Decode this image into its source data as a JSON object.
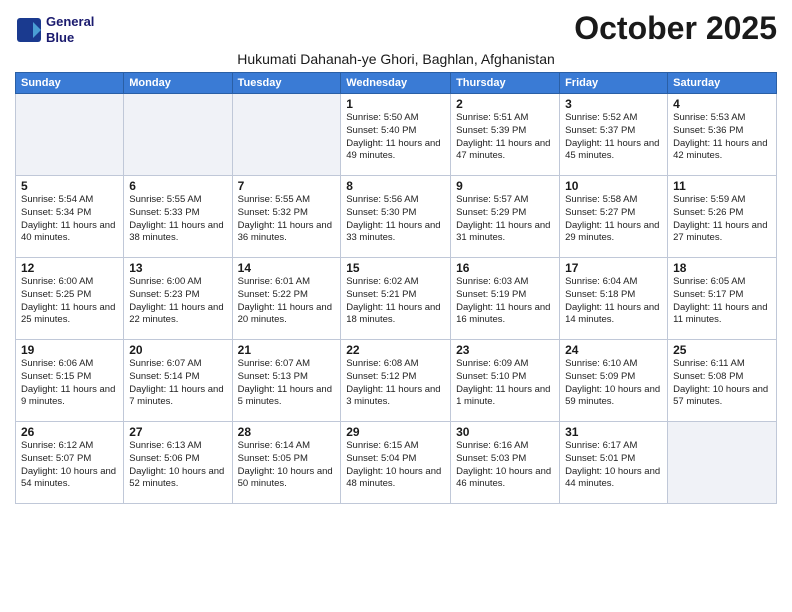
{
  "logo": {
    "line1": "General",
    "line2": "Blue"
  },
  "title": "October 2025",
  "subtitle": "Hukumati Dahanah-ye Ghori, Baghlan, Afghanistan",
  "headers": [
    "Sunday",
    "Monday",
    "Tuesday",
    "Wednesday",
    "Thursday",
    "Friday",
    "Saturday"
  ],
  "weeks": [
    [
      {
        "day": "",
        "info": ""
      },
      {
        "day": "",
        "info": ""
      },
      {
        "day": "",
        "info": ""
      },
      {
        "day": "1",
        "info": "Sunrise: 5:50 AM\nSunset: 5:40 PM\nDaylight: 11 hours\nand 49 minutes."
      },
      {
        "day": "2",
        "info": "Sunrise: 5:51 AM\nSunset: 5:39 PM\nDaylight: 11 hours\nand 47 minutes."
      },
      {
        "day": "3",
        "info": "Sunrise: 5:52 AM\nSunset: 5:37 PM\nDaylight: 11 hours\nand 45 minutes."
      },
      {
        "day": "4",
        "info": "Sunrise: 5:53 AM\nSunset: 5:36 PM\nDaylight: 11 hours\nand 42 minutes."
      }
    ],
    [
      {
        "day": "5",
        "info": "Sunrise: 5:54 AM\nSunset: 5:34 PM\nDaylight: 11 hours\nand 40 minutes."
      },
      {
        "day": "6",
        "info": "Sunrise: 5:55 AM\nSunset: 5:33 PM\nDaylight: 11 hours\nand 38 minutes."
      },
      {
        "day": "7",
        "info": "Sunrise: 5:55 AM\nSunset: 5:32 PM\nDaylight: 11 hours\nand 36 minutes."
      },
      {
        "day": "8",
        "info": "Sunrise: 5:56 AM\nSunset: 5:30 PM\nDaylight: 11 hours\nand 33 minutes."
      },
      {
        "day": "9",
        "info": "Sunrise: 5:57 AM\nSunset: 5:29 PM\nDaylight: 11 hours\nand 31 minutes."
      },
      {
        "day": "10",
        "info": "Sunrise: 5:58 AM\nSunset: 5:27 PM\nDaylight: 11 hours\nand 29 minutes."
      },
      {
        "day": "11",
        "info": "Sunrise: 5:59 AM\nSunset: 5:26 PM\nDaylight: 11 hours\nand 27 minutes."
      }
    ],
    [
      {
        "day": "12",
        "info": "Sunrise: 6:00 AM\nSunset: 5:25 PM\nDaylight: 11 hours\nand 25 minutes."
      },
      {
        "day": "13",
        "info": "Sunrise: 6:00 AM\nSunset: 5:23 PM\nDaylight: 11 hours\nand 22 minutes."
      },
      {
        "day": "14",
        "info": "Sunrise: 6:01 AM\nSunset: 5:22 PM\nDaylight: 11 hours\nand 20 minutes."
      },
      {
        "day": "15",
        "info": "Sunrise: 6:02 AM\nSunset: 5:21 PM\nDaylight: 11 hours\nand 18 minutes."
      },
      {
        "day": "16",
        "info": "Sunrise: 6:03 AM\nSunset: 5:19 PM\nDaylight: 11 hours\nand 16 minutes."
      },
      {
        "day": "17",
        "info": "Sunrise: 6:04 AM\nSunset: 5:18 PM\nDaylight: 11 hours\nand 14 minutes."
      },
      {
        "day": "18",
        "info": "Sunrise: 6:05 AM\nSunset: 5:17 PM\nDaylight: 11 hours\nand 11 minutes."
      }
    ],
    [
      {
        "day": "19",
        "info": "Sunrise: 6:06 AM\nSunset: 5:15 PM\nDaylight: 11 hours\nand 9 minutes."
      },
      {
        "day": "20",
        "info": "Sunrise: 6:07 AM\nSunset: 5:14 PM\nDaylight: 11 hours\nand 7 minutes."
      },
      {
        "day": "21",
        "info": "Sunrise: 6:07 AM\nSunset: 5:13 PM\nDaylight: 11 hours\nand 5 minutes."
      },
      {
        "day": "22",
        "info": "Sunrise: 6:08 AM\nSunset: 5:12 PM\nDaylight: 11 hours\nand 3 minutes."
      },
      {
        "day": "23",
        "info": "Sunrise: 6:09 AM\nSunset: 5:10 PM\nDaylight: 11 hours\nand 1 minute."
      },
      {
        "day": "24",
        "info": "Sunrise: 6:10 AM\nSunset: 5:09 PM\nDaylight: 10 hours\nand 59 minutes."
      },
      {
        "day": "25",
        "info": "Sunrise: 6:11 AM\nSunset: 5:08 PM\nDaylight: 10 hours\nand 57 minutes."
      }
    ],
    [
      {
        "day": "26",
        "info": "Sunrise: 6:12 AM\nSunset: 5:07 PM\nDaylight: 10 hours\nand 54 minutes."
      },
      {
        "day": "27",
        "info": "Sunrise: 6:13 AM\nSunset: 5:06 PM\nDaylight: 10 hours\nand 52 minutes."
      },
      {
        "day": "28",
        "info": "Sunrise: 6:14 AM\nSunset: 5:05 PM\nDaylight: 10 hours\nand 50 minutes."
      },
      {
        "day": "29",
        "info": "Sunrise: 6:15 AM\nSunset: 5:04 PM\nDaylight: 10 hours\nand 48 minutes."
      },
      {
        "day": "30",
        "info": "Sunrise: 6:16 AM\nSunset: 5:03 PM\nDaylight: 10 hours\nand 46 minutes."
      },
      {
        "day": "31",
        "info": "Sunrise: 6:17 AM\nSunset: 5:01 PM\nDaylight: 10 hours\nand 44 minutes."
      },
      {
        "day": "",
        "info": ""
      }
    ]
  ]
}
